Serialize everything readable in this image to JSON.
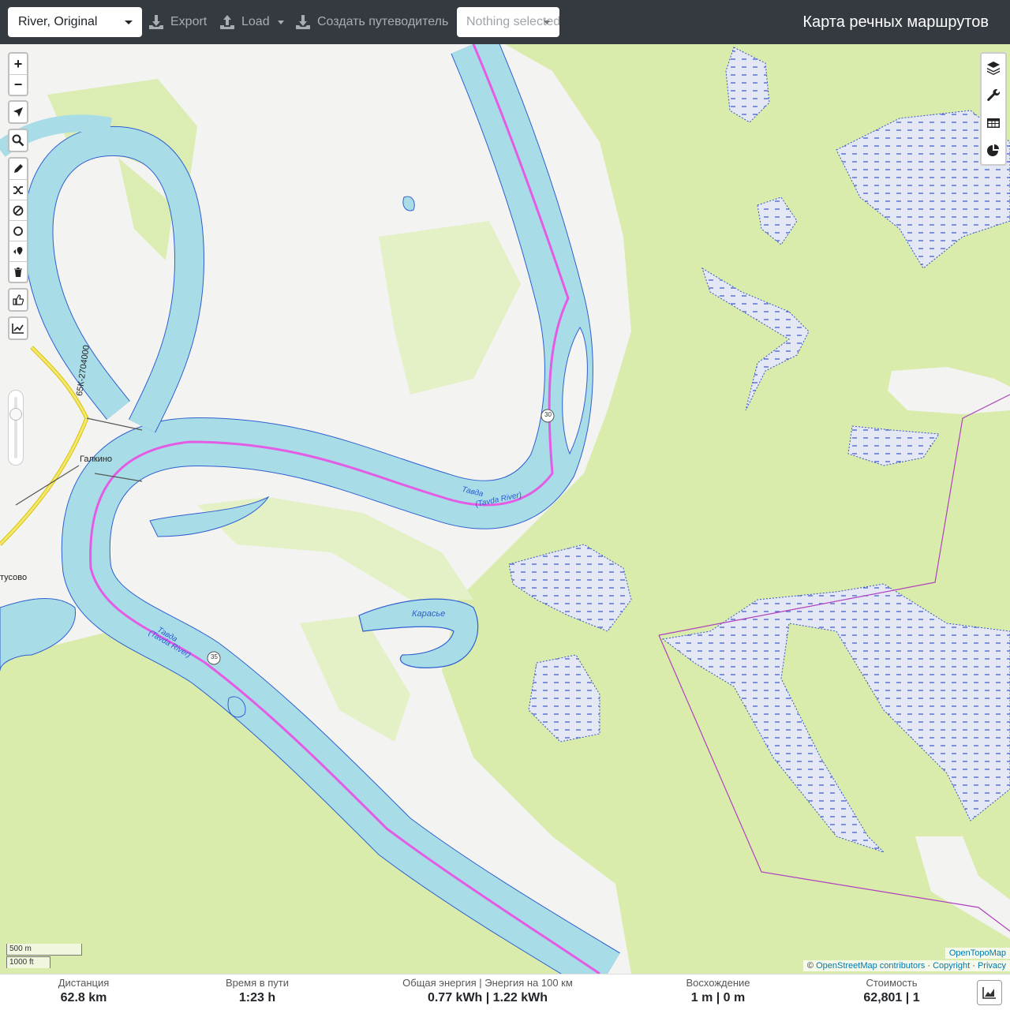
{
  "topbar": {
    "profile": "River, Original",
    "export_label": "Export",
    "load_label": "Load",
    "guide_label": "Создать путеводитель",
    "nothing_selected": "Nothing selected",
    "app_title": "Карта речных маршрутов"
  },
  "map": {
    "labels": {
      "village_galkino": "Галкино",
      "village_tusovo": "тусово",
      "road": "65К-2704000",
      "river_upper": "Тавда",
      "river_upper_en": "(Tavda River)",
      "river_lower": "Тавда",
      "river_lower_en": "(Tavda River)",
      "lake": "Карасье",
      "marker_30": "30",
      "marker_35": "35"
    },
    "zoom_in": "+",
    "zoom_out": "−",
    "zoom_level_fraction": 0.75,
    "scale_metric": "500 m",
    "scale_imperial": "1000 ft",
    "attribution_topo": "OpenTopoMap",
    "attribution_copy": "©",
    "attribution_osm": "OpenStreetMap contributors",
    "attribution_sep1": "·",
    "attribution_copyright": "Copyright",
    "attribution_sep2": "·",
    "attribution_privacy": "Privacy"
  },
  "left_controls": [
    "zoom-in",
    "zoom-out",
    "locate-arrow-icon",
    "search-icon",
    "pencil-icon",
    "shuffle-icon",
    "no-go-icon",
    "circle-icon",
    "route-pin-icon",
    "trash-icon",
    "thumbs-up-icon",
    "elevation-chart-icon"
  ],
  "right_controls": [
    "layers-icon",
    "wrench-icon",
    "table-icon",
    "pie-chart-icon"
  ],
  "stats": {
    "distance_label": "Дистанция",
    "distance_value": "62.8",
    "distance_unit": "km",
    "time_label": "Время в пути",
    "time_value": "1:23",
    "time_unit": "h",
    "energy_label": "Общая энергия | Энергия на 100 км",
    "energy_value": "0.77 kWh | 1.22 kWh",
    "ascent_label": "Восхождение",
    "ascent_value": "1 m | 0 m",
    "cost_label": "Стоимость",
    "cost_value": "62,801 | 1"
  },
  "colors": {
    "topbar": "#343a40",
    "water": "#a8dde8",
    "water_edge": "#2a5bd7",
    "forest": "#d8ecab",
    "route": "#e35ce3",
    "swamp": "#e3e6f4"
  }
}
